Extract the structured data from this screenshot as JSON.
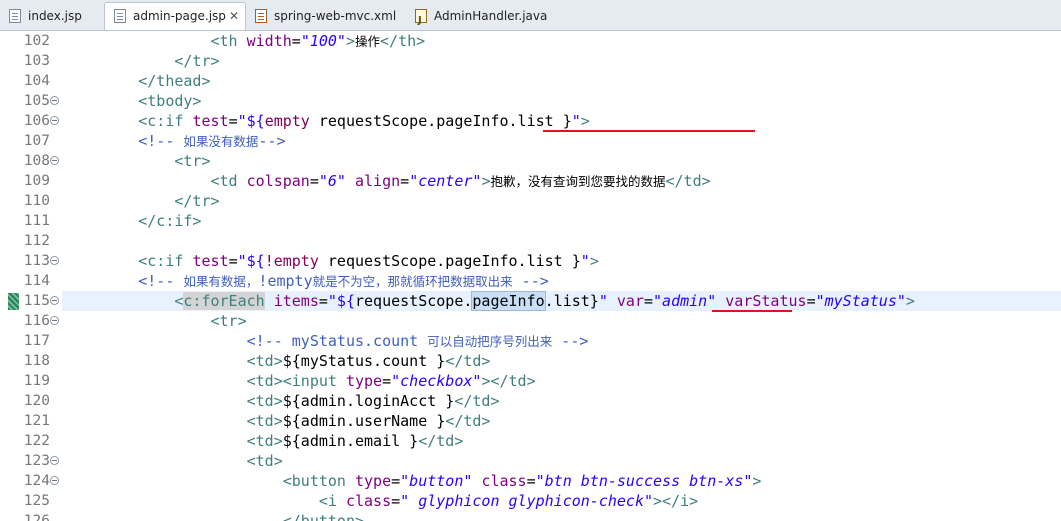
{
  "tabs": [
    {
      "label": "index.jsp",
      "icon": "jsp-file-icon",
      "active": false
    },
    {
      "label": "admin-page.jsp",
      "icon": "jsp-file-icon",
      "active": true,
      "close": "✕"
    },
    {
      "label": "spring-web-mvc.xml",
      "icon": "xml-file-icon",
      "active": false
    },
    {
      "label": "AdminHandler.java",
      "icon": "java-file-icon",
      "active": false
    }
  ],
  "lines": [
    {
      "n": "102",
      "fold": false,
      "tokens": [
        {
          "t": "sp",
          "s": "                "
        },
        {
          "t": "t",
          "s": "<th "
        },
        {
          "t": "a",
          "s": "width"
        },
        {
          "t": "txt",
          "s": "="
        },
        {
          "t": "v",
          "s": "\"100\""
        },
        {
          "t": "t",
          "s": ">"
        },
        {
          "t": "cjk",
          "s": "操作"
        },
        {
          "t": "t",
          "s": "</th>"
        }
      ]
    },
    {
      "n": "103",
      "fold": false,
      "tokens": [
        {
          "t": "sp",
          "s": "            "
        },
        {
          "t": "t",
          "s": "</tr>"
        }
      ]
    },
    {
      "n": "104",
      "fold": false,
      "tokens": [
        {
          "t": "sp",
          "s": "        "
        },
        {
          "t": "t",
          "s": "</thead>"
        }
      ]
    },
    {
      "n": "105",
      "fold": true,
      "tokens": [
        {
          "t": "sp",
          "s": "        "
        },
        {
          "t": "t",
          "s": "<tbody>"
        }
      ]
    },
    {
      "n": "106",
      "fold": true,
      "tokens": [
        {
          "t": "sp",
          "s": "        "
        },
        {
          "t": "t",
          "s": "<c:if "
        },
        {
          "t": "a",
          "s": "test"
        },
        {
          "t": "txt",
          "s": "="
        },
        {
          "t": "q",
          "s": "\"${"
        },
        {
          "t": "kw",
          "s": "empty"
        },
        {
          "t": "el",
          "s": " requestScope.pageInfo.list }"
        },
        {
          "t": "q",
          "s": "\""
        },
        {
          "t": "t",
          "s": ">"
        }
      ]
    },
    {
      "n": "107",
      "fold": false,
      "tokens": [
        {
          "t": "sp",
          "s": "        "
        },
        {
          "t": "c",
          "s": "<!-- "
        },
        {
          "t": "c-cjk",
          "s": "如果没有数据"
        },
        {
          "t": "c",
          "s": "-->"
        }
      ]
    },
    {
      "n": "108",
      "fold": true,
      "tokens": [
        {
          "t": "sp",
          "s": "            "
        },
        {
          "t": "t",
          "s": "<tr>"
        }
      ]
    },
    {
      "n": "109",
      "fold": false,
      "tokens": [
        {
          "t": "sp",
          "s": "                "
        },
        {
          "t": "t",
          "s": "<td "
        },
        {
          "t": "a",
          "s": "colspan"
        },
        {
          "t": "txt",
          "s": "="
        },
        {
          "t": "v",
          "s": "\"6\""
        },
        {
          "t": "txt",
          "s": " "
        },
        {
          "t": "a",
          "s": "align"
        },
        {
          "t": "txt",
          "s": "="
        },
        {
          "t": "v",
          "s": "\"center\""
        },
        {
          "t": "t",
          "s": ">"
        },
        {
          "t": "cjk",
          "s": "抱歉，没有查询到您要找的数据"
        },
        {
          "t": "t",
          "s": "</td>"
        }
      ]
    },
    {
      "n": "110",
      "fold": false,
      "tokens": [
        {
          "t": "sp",
          "s": "            "
        },
        {
          "t": "t",
          "s": "</tr>"
        }
      ]
    },
    {
      "n": "111",
      "fold": false,
      "tokens": [
        {
          "t": "sp",
          "s": "        "
        },
        {
          "t": "t",
          "s": "</c:if>"
        }
      ]
    },
    {
      "n": "112",
      "fold": false,
      "tokens": []
    },
    {
      "n": "113",
      "fold": true,
      "tokens": [
        {
          "t": "sp",
          "s": "        "
        },
        {
          "t": "t",
          "s": "<c:if "
        },
        {
          "t": "a",
          "s": "test"
        },
        {
          "t": "txt",
          "s": "="
        },
        {
          "t": "q",
          "s": "\"${"
        },
        {
          "t": "kw",
          "s": "!empty"
        },
        {
          "t": "el",
          "s": " requestScope.pageInfo.list }"
        },
        {
          "t": "q",
          "s": "\""
        },
        {
          "t": "t",
          "s": ">"
        }
      ]
    },
    {
      "n": "114",
      "fold": false,
      "tokens": [
        {
          "t": "sp",
          "s": "        "
        },
        {
          "t": "c",
          "s": "<!-- "
        },
        {
          "t": "c-cjk",
          "s": "如果有数据，"
        },
        {
          "t": "c",
          "s": "!empty"
        },
        {
          "t": "c-cjk",
          "s": "就是不为空，那就循环把数据取出来"
        },
        {
          "t": "c",
          "s": " -->"
        }
      ]
    },
    {
      "n": "115",
      "fold": true,
      "current": true,
      "tokens": [
        {
          "t": "sp",
          "s": "            "
        },
        {
          "t": "t",
          "s": "<"
        },
        {
          "t": "t-grey",
          "s": "c:forEach"
        },
        {
          "t": "txt",
          "s": " "
        },
        {
          "t": "a",
          "s": "items"
        },
        {
          "t": "txt",
          "s": "="
        },
        {
          "t": "q",
          "s": "\"${"
        },
        {
          "t": "el",
          "s": "requestScope."
        },
        {
          "t": "el-occ",
          "s": "pageInfo"
        },
        {
          "t": "el",
          "s": ".list}"
        },
        {
          "t": "q",
          "s": "\""
        },
        {
          "t": "txt",
          "s": " "
        },
        {
          "t": "a",
          "s": "var"
        },
        {
          "t": "txt",
          "s": "="
        },
        {
          "t": "v",
          "s": "\"admin\""
        },
        {
          "t": "txt",
          "s": " "
        },
        {
          "t": "a",
          "s": "varStatus"
        },
        {
          "t": "txt",
          "s": "="
        },
        {
          "t": "v",
          "s": "\"myStatus\""
        },
        {
          "t": "t",
          "s": ">"
        }
      ]
    },
    {
      "n": "116",
      "fold": true,
      "tokens": [
        {
          "t": "sp",
          "s": "                "
        },
        {
          "t": "t",
          "s": "<tr>"
        }
      ]
    },
    {
      "n": "117",
      "fold": false,
      "tokens": [
        {
          "t": "sp",
          "s": "                    "
        },
        {
          "t": "c",
          "s": "<!-- myStatus.count "
        },
        {
          "t": "c-cjk",
          "s": "可以自动把序号列出来"
        },
        {
          "t": "c",
          "s": " -->"
        }
      ]
    },
    {
      "n": "118",
      "fold": false,
      "tokens": [
        {
          "t": "sp",
          "s": "                    "
        },
        {
          "t": "t",
          "s": "<td>"
        },
        {
          "t": "el",
          "s": "${myStatus.count }"
        },
        {
          "t": "t",
          "s": "</td>"
        }
      ]
    },
    {
      "n": "119",
      "fold": false,
      "tokens": [
        {
          "t": "sp",
          "s": "                    "
        },
        {
          "t": "t",
          "s": "<td><input "
        },
        {
          "t": "a",
          "s": "type"
        },
        {
          "t": "txt",
          "s": "="
        },
        {
          "t": "v",
          "s": "\"checkbox\""
        },
        {
          "t": "t",
          "s": "></td>"
        }
      ]
    },
    {
      "n": "120",
      "fold": false,
      "tokens": [
        {
          "t": "sp",
          "s": "                    "
        },
        {
          "t": "t",
          "s": "<td>"
        },
        {
          "t": "el",
          "s": "${admin.loginAcct }"
        },
        {
          "t": "t",
          "s": "</td>"
        }
      ]
    },
    {
      "n": "121",
      "fold": false,
      "tokens": [
        {
          "t": "sp",
          "s": "                    "
        },
        {
          "t": "t",
          "s": "<td>"
        },
        {
          "t": "el",
          "s": "${admin.userName }"
        },
        {
          "t": "t",
          "s": "</td>"
        }
      ]
    },
    {
      "n": "122",
      "fold": false,
      "tokens": [
        {
          "t": "sp",
          "s": "                    "
        },
        {
          "t": "t",
          "s": "<td>"
        },
        {
          "t": "el",
          "s": "${admin.email }"
        },
        {
          "t": "t",
          "s": "</td>"
        }
      ]
    },
    {
      "n": "123",
      "fold": true,
      "tokens": [
        {
          "t": "sp",
          "s": "                    "
        },
        {
          "t": "t",
          "s": "<td>"
        }
      ]
    },
    {
      "n": "124",
      "fold": true,
      "tokens": [
        {
          "t": "sp",
          "s": "                        "
        },
        {
          "t": "t",
          "s": "<button "
        },
        {
          "t": "a",
          "s": "type"
        },
        {
          "t": "txt",
          "s": "="
        },
        {
          "t": "v",
          "s": "\"button\""
        },
        {
          "t": "txt",
          "s": " "
        },
        {
          "t": "a",
          "s": "class"
        },
        {
          "t": "txt",
          "s": "="
        },
        {
          "t": "v",
          "s": "\"btn btn-success btn-xs\""
        },
        {
          "t": "t",
          "s": ">"
        }
      ]
    },
    {
      "n": "125",
      "fold": false,
      "tokens": [
        {
          "t": "sp",
          "s": "                            "
        },
        {
          "t": "t",
          "s": "<i "
        },
        {
          "t": "a",
          "s": "class"
        },
        {
          "t": "txt",
          "s": "="
        },
        {
          "t": "v",
          "s": "\" glyphicon glyphicon-check\""
        },
        {
          "t": "t",
          "s": "></i>"
        }
      ]
    },
    {
      "n": "126",
      "fold": false,
      "tokens": [
        {
          "t": "sp",
          "s": "                        "
        },
        {
          "t": "t",
          "s": "</button>"
        }
      ]
    }
  ],
  "colors": {
    "tag": "#3f7f7f",
    "attr": "#7f007f",
    "value": "#2a00ff",
    "comment": "#3f5fbf",
    "keyword": "#7f0055",
    "underline": "#e0141e"
  }
}
